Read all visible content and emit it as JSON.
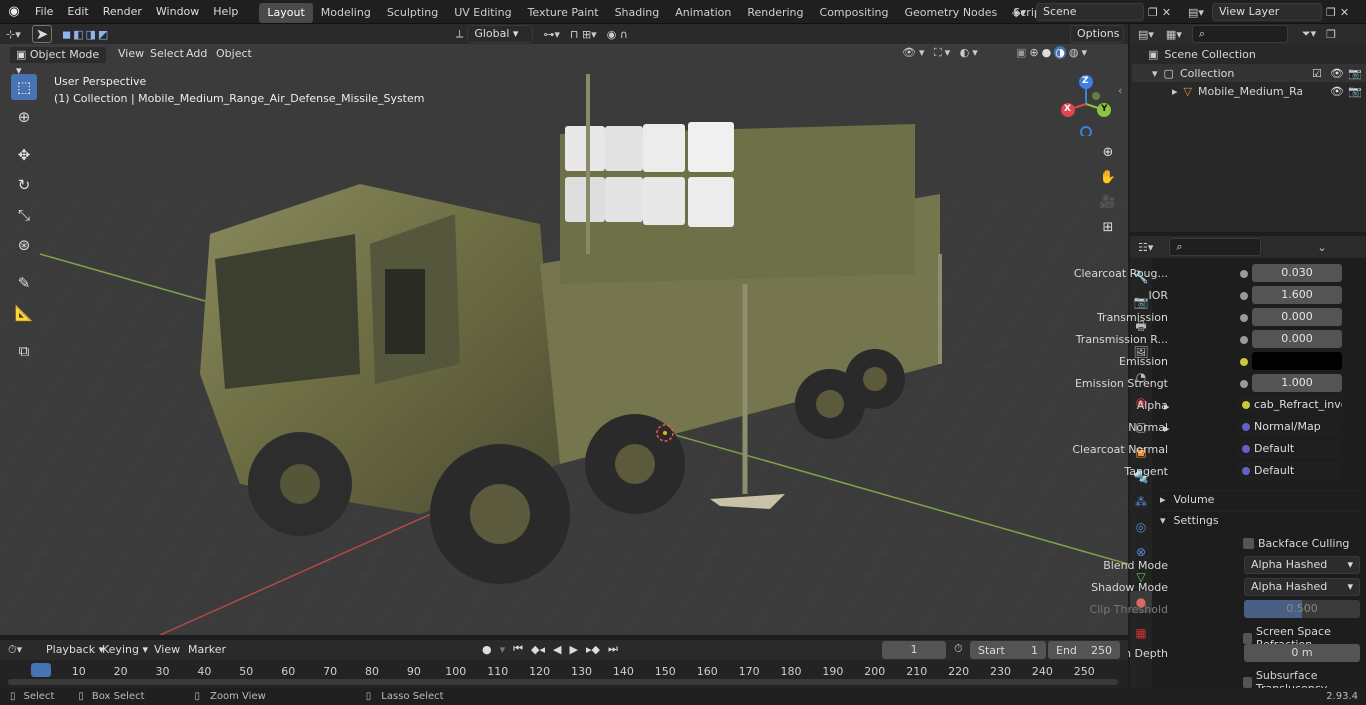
{
  "topbar": {
    "menus": [
      "File",
      "Edit",
      "Render",
      "Window",
      "Help"
    ],
    "workspaces": [
      "Layout",
      "Modeling",
      "Sculpting",
      "UV Editing",
      "Texture Paint",
      "Shading",
      "Animation",
      "Rendering",
      "Compositing",
      "Geometry Nodes",
      "Scripting"
    ],
    "active_workspace": "Layout",
    "scene": "Scene",
    "view_layer": "View Layer"
  },
  "viewport_header": {
    "mode": "Object Mode",
    "menus": [
      "View",
      "Select",
      "Add",
      "Object"
    ],
    "transform_orientation": "Global",
    "options": "Options"
  },
  "viewport": {
    "perspective": "User Perspective",
    "object_info": "(1) Collection | Mobile_Medium_Range_Air_Defense_Missile_System",
    "gizmo": {
      "x": "X",
      "y": "Y",
      "z": "Z"
    },
    "colors": {
      "x": "#e0444e",
      "y": "#8bc53f",
      "z": "#3f7fe0"
    }
  },
  "outliner": {
    "scene_collection": "Scene Collection",
    "collection": "Collection",
    "object": "Mobile_Medium_Range_A"
  },
  "properties": {
    "rows": [
      {
        "label": "Clearcoat Roug...",
        "value": "0.030"
      },
      {
        "label": "IOR",
        "value": "1.600"
      },
      {
        "label": "Transmission",
        "value": "0.000"
      },
      {
        "label": "Transmission R...",
        "value": "0.000"
      },
      {
        "label": "Emission",
        "value": ""
      },
      {
        "label": "Emission Strengt",
        "value": "1.000"
      }
    ],
    "links": [
      {
        "label": "Alpha",
        "value": "cab_Refract_invert.p..."
      },
      {
        "label": "Normal",
        "value": "Normal/Map"
      },
      {
        "label": "Clearcoat Normal",
        "value": "Default"
      },
      {
        "label": "Tangent",
        "value": "Default"
      }
    ],
    "volume": "Volume",
    "settings": "Settings",
    "backface_culling": "Backface Culling",
    "blend_mode_label": "Blend Mode",
    "blend_mode": "Alpha Hashed",
    "shadow_mode_label": "Shadow Mode",
    "shadow_mode": "Alpha Hashed",
    "clip_threshold_label": "Clip Threshold",
    "clip_threshold": "0.500",
    "screen_space_refraction": "Screen Space Refraction",
    "refraction_depth_label": "Refraction Depth",
    "refraction_depth": "0 m",
    "subsurface_translucency": "Subsurface Translucency"
  },
  "timeline": {
    "menus": [
      "Playback",
      "Keying",
      "View",
      "Marker"
    ],
    "current_frame": "1",
    "start_label": "Start",
    "start": "1",
    "end_label": "End",
    "end": "250",
    "ticks": [
      "1",
      "10",
      "20",
      "30",
      "40",
      "50",
      "60",
      "70",
      "80",
      "90",
      "100",
      "110",
      "120",
      "130",
      "140",
      "150",
      "160",
      "170",
      "180",
      "190",
      "200",
      "210",
      "220",
      "230",
      "240",
      "250"
    ]
  },
  "statusbar": {
    "select": "Select",
    "box_select": "Box Select",
    "zoom_view": "Zoom View",
    "lasso_select": "Lasso Select",
    "version": "2.93.4"
  }
}
